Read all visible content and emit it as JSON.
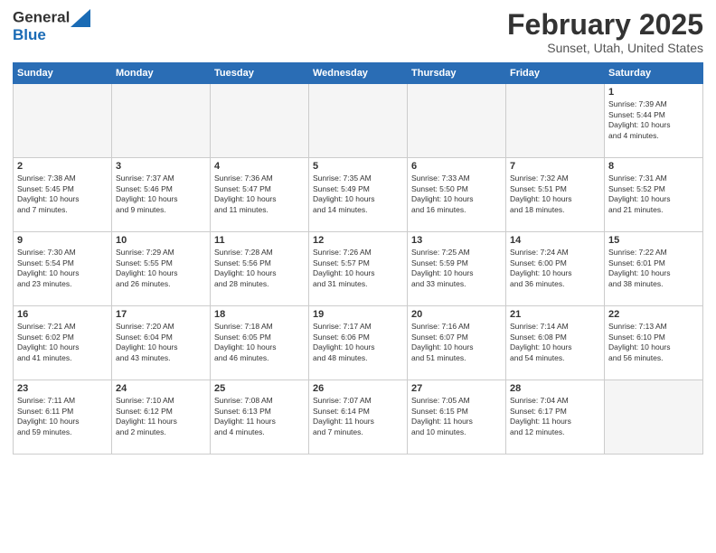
{
  "header": {
    "logo_general": "General",
    "logo_blue": "Blue",
    "month_title": "February 2025",
    "location": "Sunset, Utah, United States"
  },
  "weekdays": [
    "Sunday",
    "Monday",
    "Tuesday",
    "Wednesday",
    "Thursday",
    "Friday",
    "Saturday"
  ],
  "weeks": [
    [
      {
        "day": "",
        "detail": ""
      },
      {
        "day": "",
        "detail": ""
      },
      {
        "day": "",
        "detail": ""
      },
      {
        "day": "",
        "detail": ""
      },
      {
        "day": "",
        "detail": ""
      },
      {
        "day": "",
        "detail": ""
      },
      {
        "day": "1",
        "detail": "Sunrise: 7:39 AM\nSunset: 5:44 PM\nDaylight: 10 hours\nand 4 minutes."
      }
    ],
    [
      {
        "day": "2",
        "detail": "Sunrise: 7:38 AM\nSunset: 5:45 PM\nDaylight: 10 hours\nand 7 minutes."
      },
      {
        "day": "3",
        "detail": "Sunrise: 7:37 AM\nSunset: 5:46 PM\nDaylight: 10 hours\nand 9 minutes."
      },
      {
        "day": "4",
        "detail": "Sunrise: 7:36 AM\nSunset: 5:47 PM\nDaylight: 10 hours\nand 11 minutes."
      },
      {
        "day": "5",
        "detail": "Sunrise: 7:35 AM\nSunset: 5:49 PM\nDaylight: 10 hours\nand 14 minutes."
      },
      {
        "day": "6",
        "detail": "Sunrise: 7:33 AM\nSunset: 5:50 PM\nDaylight: 10 hours\nand 16 minutes."
      },
      {
        "day": "7",
        "detail": "Sunrise: 7:32 AM\nSunset: 5:51 PM\nDaylight: 10 hours\nand 18 minutes."
      },
      {
        "day": "8",
        "detail": "Sunrise: 7:31 AM\nSunset: 5:52 PM\nDaylight: 10 hours\nand 21 minutes."
      }
    ],
    [
      {
        "day": "9",
        "detail": "Sunrise: 7:30 AM\nSunset: 5:54 PM\nDaylight: 10 hours\nand 23 minutes."
      },
      {
        "day": "10",
        "detail": "Sunrise: 7:29 AM\nSunset: 5:55 PM\nDaylight: 10 hours\nand 26 minutes."
      },
      {
        "day": "11",
        "detail": "Sunrise: 7:28 AM\nSunset: 5:56 PM\nDaylight: 10 hours\nand 28 minutes."
      },
      {
        "day": "12",
        "detail": "Sunrise: 7:26 AM\nSunset: 5:57 PM\nDaylight: 10 hours\nand 31 minutes."
      },
      {
        "day": "13",
        "detail": "Sunrise: 7:25 AM\nSunset: 5:59 PM\nDaylight: 10 hours\nand 33 minutes."
      },
      {
        "day": "14",
        "detail": "Sunrise: 7:24 AM\nSunset: 6:00 PM\nDaylight: 10 hours\nand 36 minutes."
      },
      {
        "day": "15",
        "detail": "Sunrise: 7:22 AM\nSunset: 6:01 PM\nDaylight: 10 hours\nand 38 minutes."
      }
    ],
    [
      {
        "day": "16",
        "detail": "Sunrise: 7:21 AM\nSunset: 6:02 PM\nDaylight: 10 hours\nand 41 minutes."
      },
      {
        "day": "17",
        "detail": "Sunrise: 7:20 AM\nSunset: 6:04 PM\nDaylight: 10 hours\nand 43 minutes."
      },
      {
        "day": "18",
        "detail": "Sunrise: 7:18 AM\nSunset: 6:05 PM\nDaylight: 10 hours\nand 46 minutes."
      },
      {
        "day": "19",
        "detail": "Sunrise: 7:17 AM\nSunset: 6:06 PM\nDaylight: 10 hours\nand 48 minutes."
      },
      {
        "day": "20",
        "detail": "Sunrise: 7:16 AM\nSunset: 6:07 PM\nDaylight: 10 hours\nand 51 minutes."
      },
      {
        "day": "21",
        "detail": "Sunrise: 7:14 AM\nSunset: 6:08 PM\nDaylight: 10 hours\nand 54 minutes."
      },
      {
        "day": "22",
        "detail": "Sunrise: 7:13 AM\nSunset: 6:10 PM\nDaylight: 10 hours\nand 56 minutes."
      }
    ],
    [
      {
        "day": "23",
        "detail": "Sunrise: 7:11 AM\nSunset: 6:11 PM\nDaylight: 10 hours\nand 59 minutes."
      },
      {
        "day": "24",
        "detail": "Sunrise: 7:10 AM\nSunset: 6:12 PM\nDaylight: 11 hours\nand 2 minutes."
      },
      {
        "day": "25",
        "detail": "Sunrise: 7:08 AM\nSunset: 6:13 PM\nDaylight: 11 hours\nand 4 minutes."
      },
      {
        "day": "26",
        "detail": "Sunrise: 7:07 AM\nSunset: 6:14 PM\nDaylight: 11 hours\nand 7 minutes."
      },
      {
        "day": "27",
        "detail": "Sunrise: 7:05 AM\nSunset: 6:15 PM\nDaylight: 11 hours\nand 10 minutes."
      },
      {
        "day": "28",
        "detail": "Sunrise: 7:04 AM\nSunset: 6:17 PM\nDaylight: 11 hours\nand 12 minutes."
      },
      {
        "day": "",
        "detail": ""
      }
    ]
  ]
}
